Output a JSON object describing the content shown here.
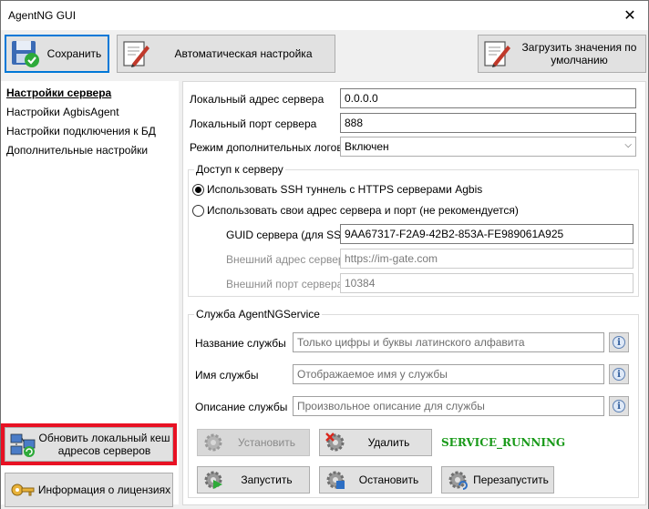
{
  "window": {
    "title": "AgentNG GUI",
    "close_glyph": "✕"
  },
  "toolbar": {
    "save_label": "Сохранить",
    "auto_config_label": "Автоматическая настройка",
    "load_defaults_label": "Загрузить значения по умолчанию"
  },
  "sidebar": {
    "items": [
      {
        "label": "Настройки сервера",
        "active": true
      },
      {
        "label": "Настройки AgbisAgent"
      },
      {
        "label": "Настройки подключения к БД"
      },
      {
        "label": "Дополнительные настройки"
      }
    ],
    "refresh_cache_label": "Обновить локальный кеш адресов серверов",
    "license_label": "Информация о лицензиях"
  },
  "server": {
    "local_address_label": "Локальный адрес сервера",
    "local_address_value": "0.0.0.0",
    "local_port_label": "Локальный порт сервера",
    "local_port_value": "888",
    "log_mode_label": "Режим дополнительных логов",
    "log_mode_value": "Включен"
  },
  "access": {
    "group_title": "Доступ к серверу",
    "ssh_option": "Использовать SSH туннель с HTTPS серверами Agbis",
    "own_option": "Использовать свои адрес сервера и порт (не рекомендуется)",
    "guid_label": "GUID сервера (для SSH)",
    "guid_value": "9AA67317-F2A9-42B2-853A-FE989061A925",
    "ext_address_label": "Внешний адрес сервера",
    "ext_address_value": "https://im-gate.com",
    "ext_port_label": "Внешний порт сервера",
    "ext_port_value": "10384"
  },
  "service": {
    "group_title": "Служба AgentNGService",
    "name_label": "Название службы",
    "name_placeholder": "Только цифры и буквы латинского алфавита",
    "display_label": "Имя службы",
    "display_placeholder": "Отображаемое имя у службы",
    "desc_label": "Описание службы",
    "desc_placeholder": "Произвольное описание для службы",
    "install_label": "Установить",
    "delete_label": "Удалить",
    "start_label": "Запустить",
    "stop_label": "Остановить",
    "restart_label": "Перезапустить",
    "status": "SERVICE_RUNNING"
  },
  "colors": {
    "status_green": "#1a9a1a",
    "highlight_red": "#e81123",
    "focus_blue": "#0078d7"
  }
}
